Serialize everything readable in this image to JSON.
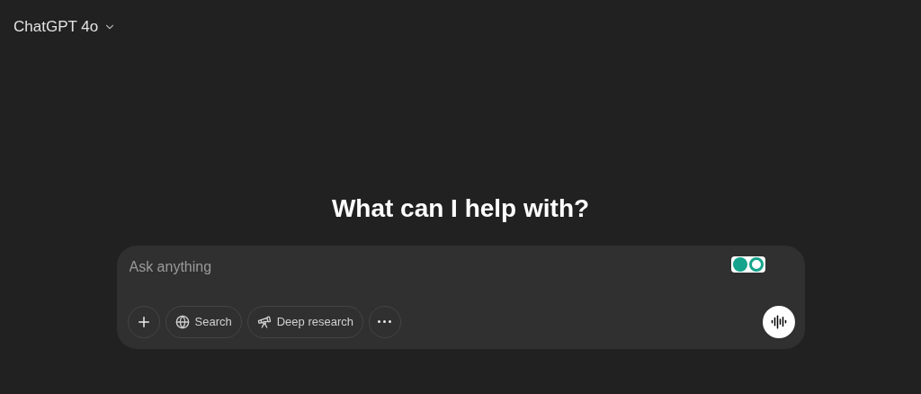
{
  "header": {
    "model": "ChatGPT 4o"
  },
  "heading": "What can I help with?",
  "composer": {
    "placeholder": "Ask anything",
    "tools": [
      {
        "kind": "plus"
      },
      {
        "kind": "search",
        "label": "Search"
      },
      {
        "kind": "research",
        "label": "Deep research"
      },
      {
        "kind": "more"
      }
    ]
  }
}
